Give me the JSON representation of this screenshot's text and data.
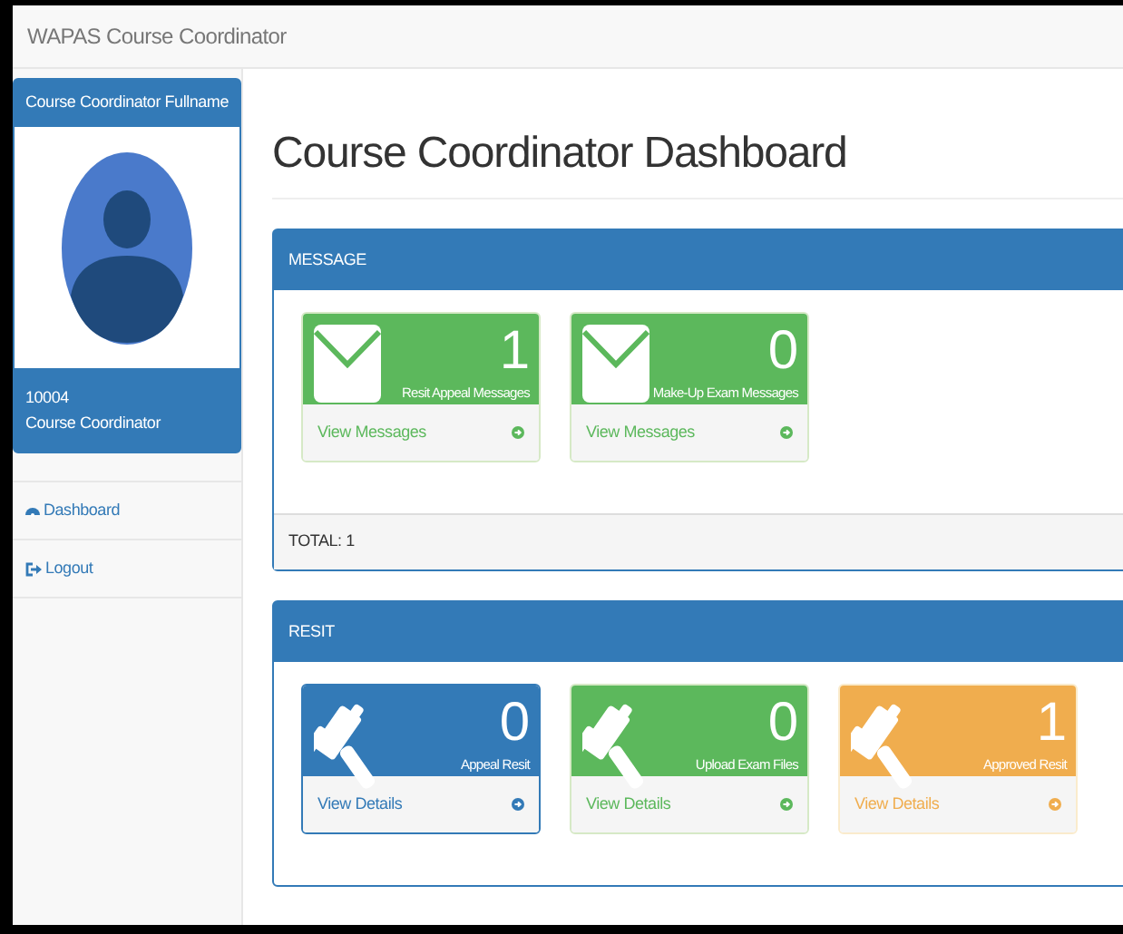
{
  "navbar": {
    "brand": "WAPAS Course Coordinator"
  },
  "sidebar": {
    "profile_title": "Course Coordinator Fullname",
    "user_id": "10004",
    "role": "Course Coordinator",
    "items": [
      {
        "label": "Dashboard"
      },
      {
        "label": "Logout"
      }
    ]
  },
  "page_title": "Course Coordinator Dashboard",
  "panels": [
    {
      "title": "MESSAGE",
      "footer": "TOTAL: 1",
      "cards": [
        {
          "kind": "success",
          "count": "1",
          "label": "Resit Appeal Messages",
          "link": "View Messages"
        },
        {
          "kind": "success",
          "count": "0",
          "label": "Make-Up Exam Messages",
          "link": "View Messages"
        }
      ]
    },
    {
      "title": "RESIT",
      "cards": [
        {
          "kind": "primary",
          "count": "0",
          "label": "Appeal Resit",
          "link": "View Details"
        },
        {
          "kind": "success",
          "count": "0",
          "label": "Upload Exam Files",
          "link": "View Details"
        },
        {
          "kind": "warning",
          "count": "1",
          "label": "Approved Resit",
          "link": "View Details"
        }
      ]
    }
  ]
}
